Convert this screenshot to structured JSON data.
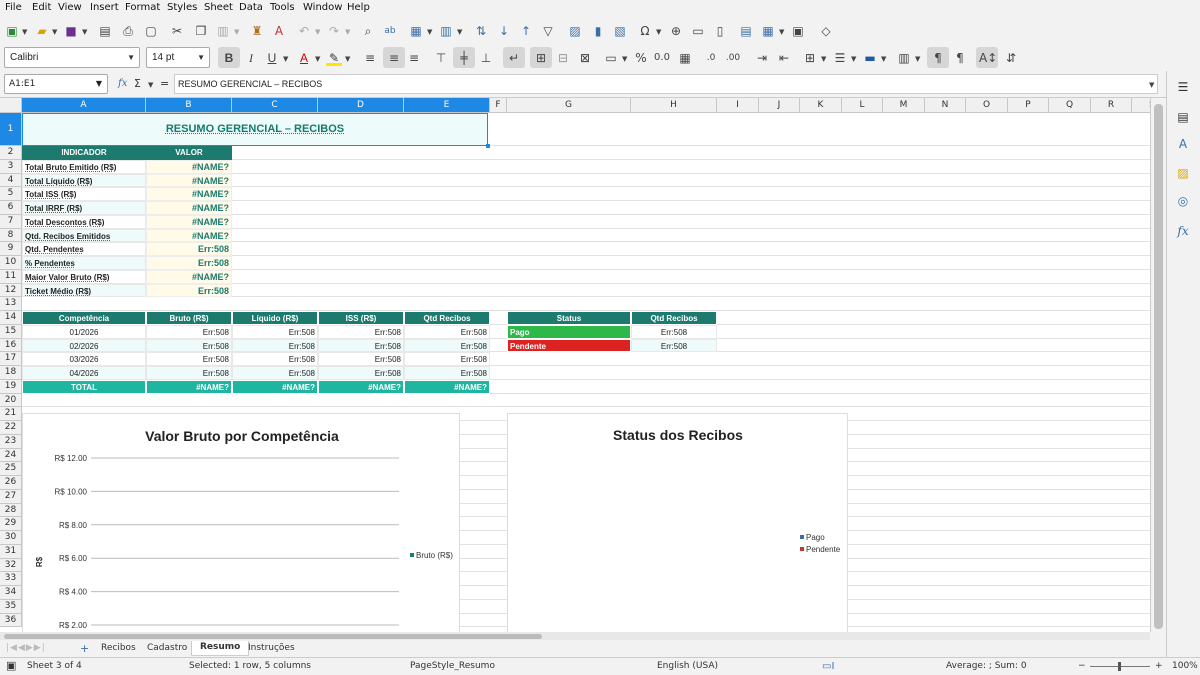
{
  "menu": [
    "File",
    "Edit",
    "View",
    "Insert",
    "Format",
    "Styles",
    "Sheet",
    "Data",
    "Tools",
    "Window",
    "Help"
  ],
  "toolbar": {
    "font_name": "Calibri",
    "font_size": "14 pt"
  },
  "formula_bar": {
    "name_box": "A1:E1",
    "fx": "fx",
    "sigma": "Σ",
    "equals": "=",
    "content": "RESUMO GERENCIAL – RECIBOS"
  },
  "columns": [
    "A",
    "B",
    "C",
    "D",
    "E",
    "F",
    "G",
    "H",
    "I",
    "J",
    "K",
    "L",
    "M",
    "N",
    "O",
    "P",
    "Q",
    "R",
    "S"
  ],
  "rows": [
    "1",
    "2",
    "3",
    "4",
    "5",
    "6",
    "7",
    "8",
    "9",
    "10",
    "11",
    "12",
    "13",
    "14",
    "15",
    "16",
    "17",
    "18",
    "19",
    "20",
    "21",
    "22",
    "23",
    "24",
    "25",
    "26",
    "27",
    "28",
    "29",
    "30",
    "31",
    "32",
    "33",
    "34",
    "35",
    "36"
  ],
  "sheet": {
    "title": "RESUMO GERENCIAL – RECIBOS",
    "indicator_header": {
      "label": "INDICADOR",
      "value": "VALOR"
    },
    "indicators": [
      {
        "label": "Total Bruto Emitido (R$)",
        "value": "#NAME?"
      },
      {
        "label": "Total Líquido (R$)",
        "value": "#NAME?"
      },
      {
        "label": "Total ISS (R$)",
        "value": "#NAME?"
      },
      {
        "label": "Total IRRF (R$)",
        "value": "#NAME?"
      },
      {
        "label": "Total Descontos (R$)",
        "value": "#NAME?"
      },
      {
        "label": "Qtd. Recibos Emitidos",
        "value": "#NAME?"
      },
      {
        "label": "Qtd. Pendentes",
        "value": "Err:508"
      },
      {
        "label": "% Pendentes",
        "value": "Err:508"
      },
      {
        "label": "Maior Valor Bruto (R$)",
        "value": "#NAME?"
      },
      {
        "label": "Ticket Médio (R$)",
        "value": "Err:508"
      }
    ],
    "period_header": [
      "Competência",
      "Bruto (R$)",
      "Líquido (R$)",
      "ISS (R$)",
      "Qtd Recibos"
    ],
    "period_rows": [
      [
        "01/2026",
        "Err:508",
        "Err:508",
        "Err:508",
        "Err:508"
      ],
      [
        "02/2026",
        "Err:508",
        "Err:508",
        "Err:508",
        "Err:508"
      ],
      [
        "03/2026",
        "Err:508",
        "Err:508",
        "Err:508",
        "Err:508"
      ],
      [
        "04/2026",
        "Err:508",
        "Err:508",
        "Err:508",
        "Err:508"
      ]
    ],
    "period_total": [
      "TOTAL",
      "#NAME?",
      "#NAME?",
      "#NAME?",
      "#NAME?"
    ],
    "status_header": [
      "Status",
      "Qtd Recibos"
    ],
    "status_rows": [
      {
        "label": "Pago",
        "value": "Err:508",
        "color": "#2fb84a"
      },
      {
        "label": "Pendente",
        "value": "Err:508",
        "color": "#dd2222"
      }
    ]
  },
  "chart_data": [
    {
      "type": "bar",
      "title": "Valor Bruto por Competência",
      "ylabel": "R$",
      "y_ticks": [
        "R$ 2.00",
        "R$ 4.00",
        "R$ 6.00",
        "R$ 8.00",
        "R$ 10.00",
        "R$ 12.00"
      ],
      "ylim": [
        0,
        12
      ],
      "series": [
        {
          "name": "Bruto (R$)",
          "values": [],
          "color": "#1c7a6e"
        }
      ],
      "legend": "right"
    },
    {
      "type": "pie",
      "title": "Status dos Recibos",
      "categories": [
        "Pago",
        "Pendente"
      ],
      "colors": [
        "#3a6ea5",
        "#c0392b"
      ],
      "values": [],
      "legend": "right"
    }
  ],
  "tabs": [
    "Recibos",
    "Cadastro",
    "Resumo",
    "Instruções"
  ],
  "status_bar": {
    "sheet": "Sheet 3 of 4",
    "selection": "Selected: 1 row, 5 columns",
    "page_style": "PageStyle_Resumo",
    "language": "English (USA)",
    "summary": "Average: ; Sum: 0",
    "zoom": "100%"
  }
}
